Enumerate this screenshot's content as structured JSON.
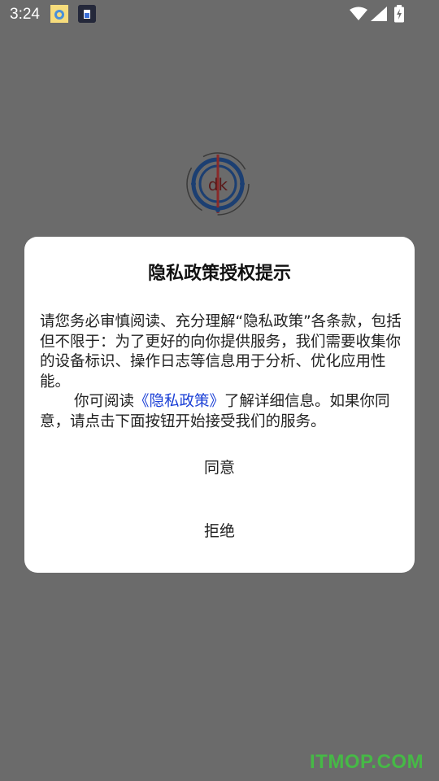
{
  "status_bar": {
    "time": "3:24",
    "icons": [
      "notification-app-icon",
      "notification-sim-icon",
      "wifi-icon",
      "signal-icon",
      "battery-charging-icon"
    ]
  },
  "splash": {
    "logo_icon": "dk-logo-icon",
    "logo_text": "dk"
  },
  "dialog": {
    "title": "隐私政策授权提示",
    "para1": "请您务必审慎阅读、充分理解“隐私政策”各条款，包括但不限于：为了更好的向你提供服务，我们需要收集你的设备标识、操作日志等信息用于分析、优化应用性能。",
    "para2_prefix": "你可阅读",
    "policy_link": "《隐私政策》",
    "para2_suffix": "了解详细信息。如果你同意，请点击下面按钮开始接受我们的服务。",
    "agree_label": "同意",
    "reject_label": "拒绝"
  },
  "watermark": "ITMOP.COM",
  "colors": {
    "overlay": "#6b6b6b",
    "link": "#1a3fd6",
    "watermark": "#46b946"
  }
}
